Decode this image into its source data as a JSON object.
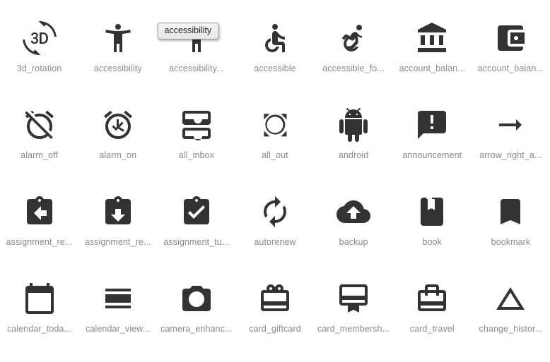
{
  "app": {
    "title": "Material Icons Gallery",
    "background_color": "#ffffff",
    "icon_color": "#333333",
    "label_color": "#8a8a8a",
    "columns": 7,
    "rows": 4
  },
  "tooltip": {
    "visible": true,
    "text": "accessibility",
    "attached_to": "accessibility_new",
    "background_color": "#eeeeee",
    "border_color": "#9a9a9a",
    "text_color": "#222222"
  },
  "icons": [
    {
      "name": "3d-rotation-icon",
      "label": "3d_rotation"
    },
    {
      "name": "accessibility-icon",
      "label": "accessibility"
    },
    {
      "name": "accessibility-new-icon",
      "label": "accessibility..."
    },
    {
      "name": "accessible-icon",
      "label": "accessible"
    },
    {
      "name": "accessible-forward-icon",
      "label": "accessible_fo..."
    },
    {
      "name": "account-balance-icon",
      "label": "account_balan..."
    },
    {
      "name": "account-balance-wallet-icon",
      "label": "account_balan..."
    },
    {
      "name": "alarm-off-icon",
      "label": "alarm_off"
    },
    {
      "name": "alarm-on-icon",
      "label": "alarm_on"
    },
    {
      "name": "all-inbox-icon",
      "label": "all_inbox"
    },
    {
      "name": "all-out-icon",
      "label": "all_out"
    },
    {
      "name": "android-icon",
      "label": "android"
    },
    {
      "name": "announcement-icon",
      "label": "announcement"
    },
    {
      "name": "arrow-right-alt-icon",
      "label": "arrow_right_a..."
    },
    {
      "name": "assignment-return-icon",
      "label": "assignment_re..."
    },
    {
      "name": "assignment-returned-icon",
      "label": "assignment_re..."
    },
    {
      "name": "assignment-turned-in-icon",
      "label": "assignment_tu..."
    },
    {
      "name": "autorenew-icon",
      "label": "autorenew"
    },
    {
      "name": "backup-icon",
      "label": "backup"
    },
    {
      "name": "book-icon",
      "label": "book"
    },
    {
      "name": "bookmark-icon",
      "label": "bookmark"
    },
    {
      "name": "calendar-today-icon",
      "label": "calendar_toda..."
    },
    {
      "name": "calendar-view-day-icon",
      "label": "calendar_view..."
    },
    {
      "name": "camera-enhance-icon",
      "label": "camera_enhanc..."
    },
    {
      "name": "card-giftcard-icon",
      "label": "card_giftcard"
    },
    {
      "name": "card-membership-icon",
      "label": "card_membersh..."
    },
    {
      "name": "card-travel-icon",
      "label": "card_travel"
    },
    {
      "name": "change-history-icon",
      "label": "change_histor..."
    }
  ]
}
